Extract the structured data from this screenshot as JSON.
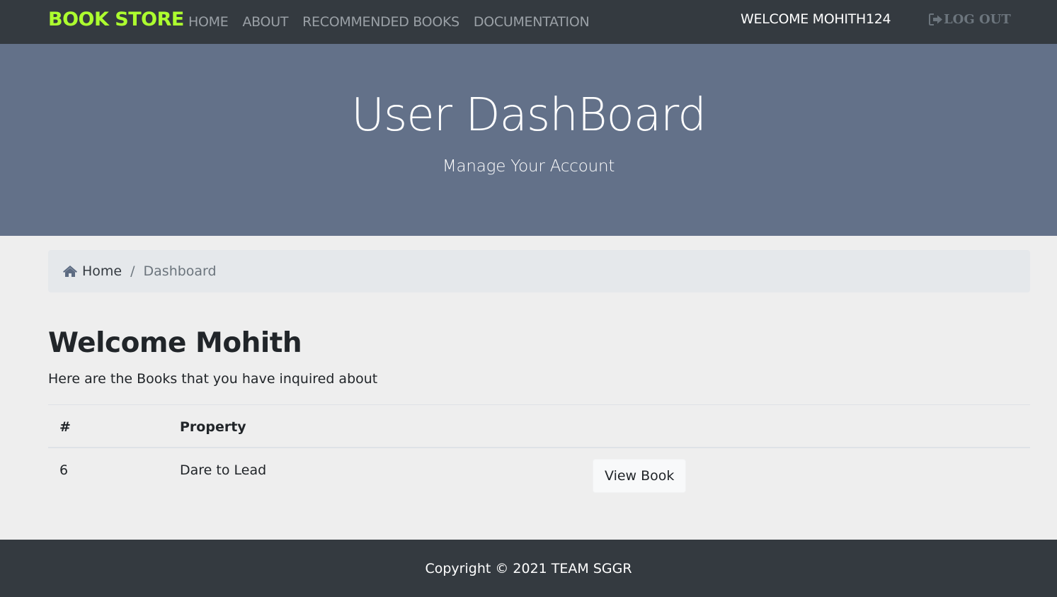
{
  "navbar": {
    "brand": "BOOK STORE",
    "links": [
      "HOME",
      "ABOUT",
      "RECOMMENDED BOOKS",
      "DOCUMENTATION"
    ],
    "welcome": "WELCOME MOHITH124",
    "logout_label": "LOG OUT",
    "logout_icon": "sign-out-icon",
    "brand_color": "#adff2f"
  },
  "hero": {
    "title": "User DashBoard",
    "subtitle": "Manage Your Account",
    "background": "#637189"
  },
  "breadcrumb": {
    "home_icon": "home-icon",
    "home_label": "Home",
    "separator": "/",
    "current": "Dashboard"
  },
  "main": {
    "title": "Welcome Mohith",
    "intro": "Here are the Books that you have inquired about",
    "table": {
      "headers": [
        "#",
        "Property"
      ],
      "rows": [
        {
          "id": "6",
          "property": "Dare to Lead",
          "action": "View Book"
        }
      ]
    }
  },
  "footer": {
    "text": "Copyright © 2021 TEAM SGGR"
  }
}
